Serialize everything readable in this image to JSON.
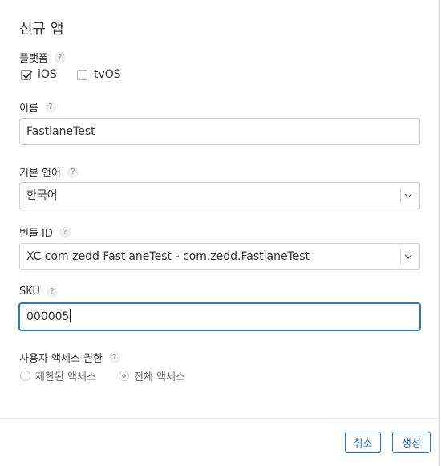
{
  "dialog": {
    "title": "신규 앱",
    "platform": {
      "label": "플랫폼",
      "options": [
        {
          "label": "iOS",
          "checked": true
        },
        {
          "label": "tvOS",
          "checked": false
        }
      ]
    },
    "name": {
      "label": "이름",
      "value": "FastlaneTest"
    },
    "language": {
      "label": "기본 언어",
      "value": "한국어"
    },
    "bundle_id": {
      "label": "번들 ID",
      "value": "XC com zedd FastlaneTest - com.zedd.FastlaneTest"
    },
    "sku": {
      "label": "SKU",
      "value": "000005"
    },
    "user_access": {
      "label": "사용자 액세스 권한",
      "options": [
        {
          "label": "제한된 액세스",
          "selected": false
        },
        {
          "label": "전체 액세스",
          "selected": true
        }
      ]
    },
    "help_glyph": "?",
    "buttons": {
      "cancel": "취소",
      "create": "생성"
    }
  },
  "colors": {
    "accent": "#2a78d6",
    "text": "#333333",
    "border": "#d0d0d0"
  }
}
